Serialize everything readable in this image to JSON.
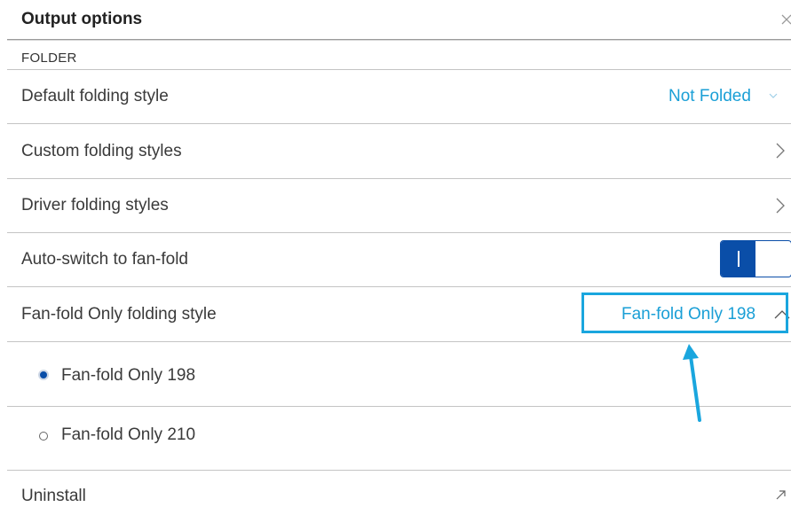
{
  "header": {
    "title": "Output options",
    "close_icon": "close-icon"
  },
  "section": {
    "label": "FOLDER"
  },
  "rows": {
    "default_folding": {
      "label": "Default folding style",
      "value": "Not Folded",
      "icon": "chevron-down-icon"
    },
    "custom_folding": {
      "label": "Custom folding styles",
      "icon": "chevron-right-icon"
    },
    "driver_folding": {
      "label": "Driver folding styles",
      "icon": "chevron-right-icon"
    },
    "auto_switch": {
      "label": "Auto-switch to fan-fold",
      "toggle_state": "on"
    },
    "fanfold_only": {
      "label": "Fan-fold Only folding style",
      "value": "Fan-fold Only 198",
      "icon": "chevron-up-icon"
    },
    "options": [
      {
        "label": "Fan-fold Only 198",
        "selected": true
      },
      {
        "label": "Fan-fold Only 210",
        "selected": false
      }
    ],
    "uninstall": {
      "label": "Uninstall",
      "icon": "external-link-icon"
    }
  },
  "colors": {
    "accent": "#1a9fd6",
    "toggle": "#0a4ea8",
    "highlight": "#1aa6de",
    "arrow": "#1aa6de"
  }
}
